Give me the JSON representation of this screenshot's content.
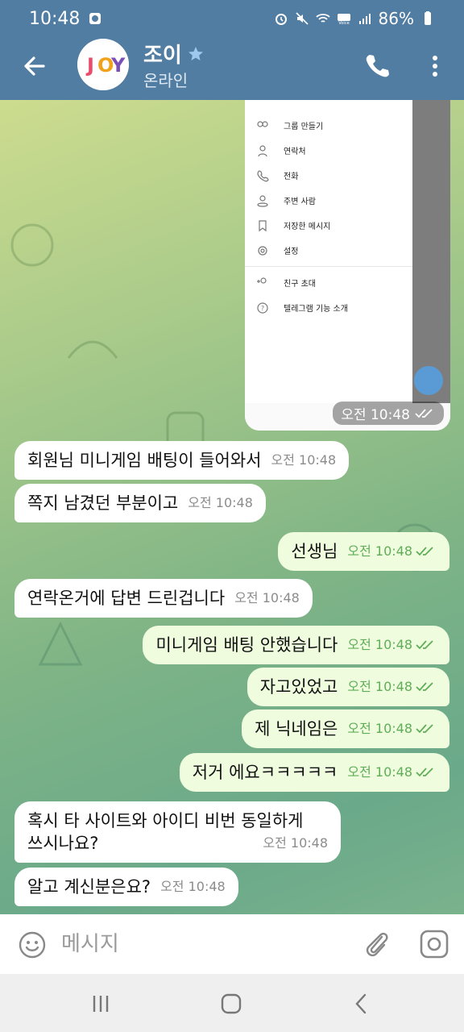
{
  "status_bar": {
    "time": "10:48",
    "battery": "86%"
  },
  "header": {
    "name": "조이",
    "status": "온라인",
    "avatar_text": "JOY"
  },
  "screenshot_menu": {
    "items": [
      {
        "label": "그룹 만들기",
        "icon": "group-icon"
      },
      {
        "label": "연락처",
        "icon": "person-icon"
      },
      {
        "label": "전화",
        "icon": "phone-icon"
      },
      {
        "label": "주변 사람",
        "icon": "nearby-icon"
      },
      {
        "label": "저장한 메시지",
        "icon": "bookmark-icon"
      },
      {
        "label": "설정",
        "icon": "settings-icon"
      }
    ],
    "items2": [
      {
        "label": "친구 초대",
        "icon": "invite-icon"
      },
      {
        "label": "텔레그램 기능 소개",
        "icon": "help-icon"
      }
    ],
    "time": "오전 10:48"
  },
  "messages": [
    {
      "dir": "in",
      "text": "회원님 미니게임 배팅이 들어와서",
      "time": "오전 10:48"
    },
    {
      "dir": "in",
      "text": "쪽지 남겼던 부분이고",
      "time": "오전 10:48"
    },
    {
      "dir": "out",
      "text": "선생님",
      "time": "오전 10:48"
    },
    {
      "dir": "in",
      "text": "연락온거에 답변 드린겁니다",
      "time": "오전 10:48"
    },
    {
      "dir": "out",
      "text": "미니게임 배팅 안했습니다",
      "time": "오전 10:48"
    },
    {
      "dir": "out",
      "text": "자고있었고",
      "time": "오전 10:48"
    },
    {
      "dir": "out",
      "text": "제 닉네임은",
      "time": "오전 10:48"
    },
    {
      "dir": "out",
      "text": "저거 에요ㅋㅋㅋㅋㅋ",
      "time": "오전 10:48"
    },
    {
      "dir": "in",
      "text": "혹시 타 사이트와 아이디 비번 동일하게",
      "text2": "쓰시나요?",
      "time": "오전 10:48"
    },
    {
      "dir": "in",
      "text": "알고 계신분은요?",
      "time": "오전 10:48"
    }
  ],
  "input": {
    "placeholder": "메시지"
  },
  "colors": {
    "header": "#517da2",
    "outgoing_bubble": "#effdde",
    "incoming_bubble": "#ffffff",
    "check_green": "#5fae57"
  }
}
